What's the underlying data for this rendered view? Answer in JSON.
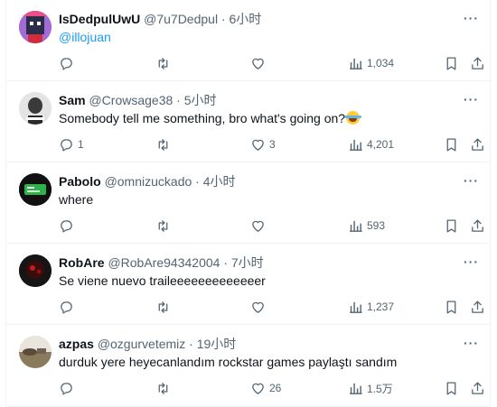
{
  "tweets": [
    {
      "name": "IsDedpulUwU",
      "handle": "@7u7Dedpul",
      "time": "· 6小时",
      "text": "",
      "mention": "@illojuan",
      "reply_count": "",
      "retweet_count": "",
      "like_count": "",
      "view_count": "1,034"
    },
    {
      "name": "Sam",
      "handle": "@Crowsage38",
      "time": "· 5小时",
      "text": "Somebody tell me something, bro what's going on?",
      "mention": "",
      "reply_count": "1",
      "retweet_count": "",
      "like_count": "3",
      "view_count": "4,201"
    },
    {
      "name": "Pabolo",
      "handle": "@omnizuckado",
      "time": "· 4小时",
      "text": "where",
      "mention": "",
      "reply_count": "",
      "retweet_count": "",
      "like_count": "",
      "view_count": "593"
    },
    {
      "name": "RobAre",
      "handle": "@RobAre94342004",
      "time": "· 7小时",
      "text": "Se viene nuevo traileeeeeeeeeeeeer",
      "mention": "",
      "reply_count": "",
      "retweet_count": "",
      "like_count": "",
      "view_count": "1,237"
    },
    {
      "name": "azpas",
      "handle": "@ozgurvetemiz",
      "time": "· 19小时",
      "text": "durduk yere heyecanlandım rockstar games paylaştı sandım",
      "mention": "",
      "reply_count": "",
      "retweet_count": "",
      "like_count": "26",
      "view_count": "1.5万"
    }
  ],
  "more_glyph": "···",
  "colors": {
    "accent": "#1d9bf0",
    "text": "#0f1419",
    "muted": "#536471",
    "border": "#eff3f4"
  },
  "icons": [
    "reply-icon",
    "retweet-icon",
    "like-icon",
    "views-icon",
    "bookmark-icon",
    "share-icon",
    "more-icon",
    "laughing-emoji"
  ]
}
